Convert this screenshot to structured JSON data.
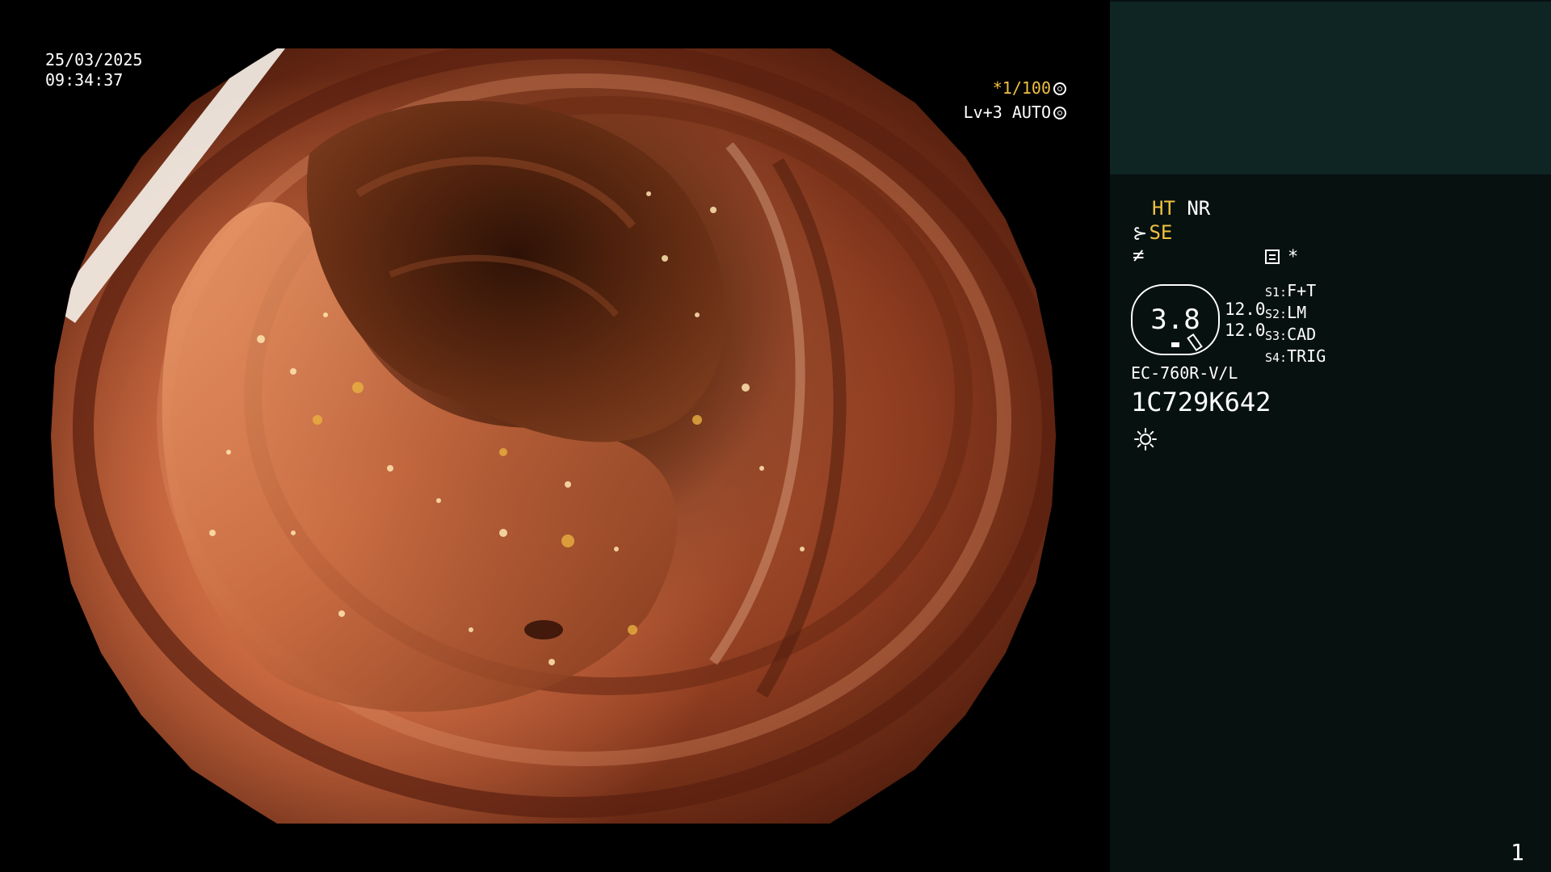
{
  "scope_view": {
    "date": "25/03/2025",
    "time": "09:34:37",
    "shutter": "*1/100",
    "level": "Lv+3 AUTO",
    "icons": [
      "aperture-icon",
      "iris-icon"
    ]
  },
  "side_panel": {
    "mode_ht": "HT",
    "mode_nr": "NR",
    "se_label": "SE",
    "f_glyph": "≠",
    "se_glyph": "⊱",
    "star": "*",
    "gauge_value": "3.8",
    "gauge_values": [
      "12.0",
      "12.0"
    ],
    "switches": [
      {
        "key": "S1:",
        "value": "F+T"
      },
      {
        "key": "S2:",
        "value": "LM"
      },
      {
        "key": "S3:",
        "value": "CAD"
      },
      {
        "key": "S4:",
        "value": "TRIG"
      }
    ],
    "scope_model": "EC-760R-V/L",
    "serial": "1C729K642",
    "page_number": "1"
  },
  "colors": {
    "accent_yellow": "#f0c040",
    "panel_top": "#0e2524",
    "panel_bg": "#071110"
  }
}
